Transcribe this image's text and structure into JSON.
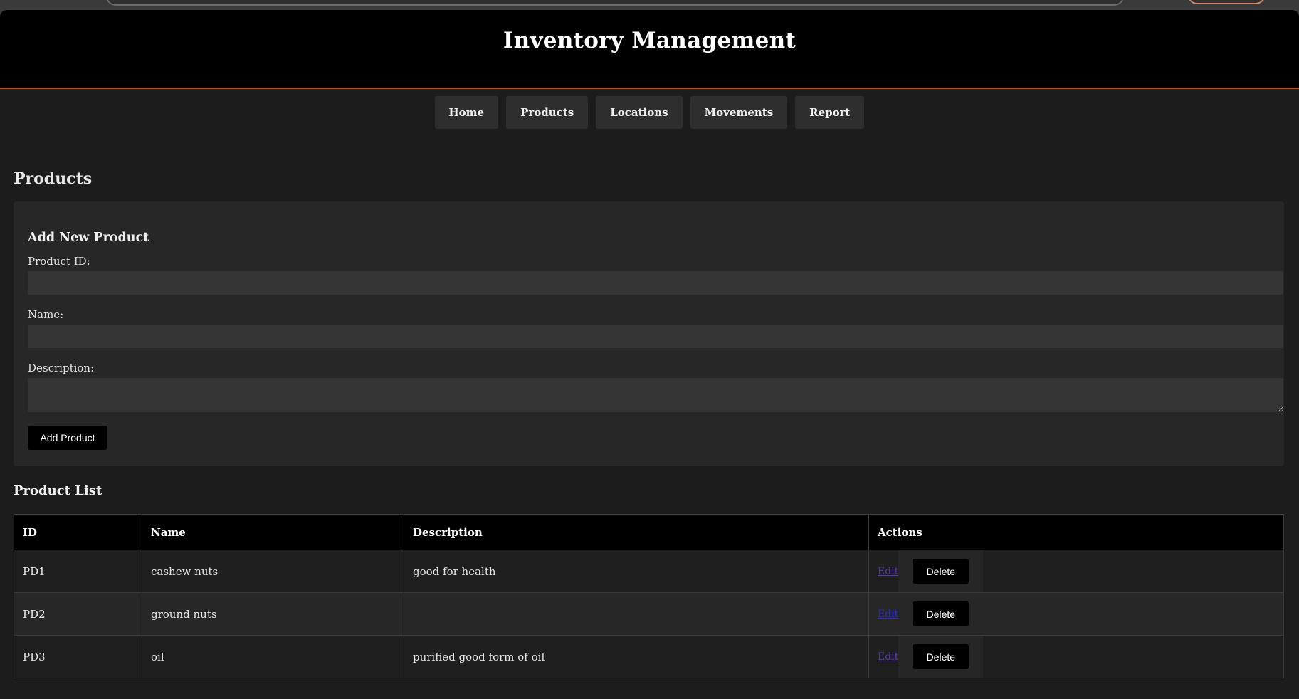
{
  "header": {
    "title": "Inventory Management"
  },
  "nav": {
    "items": [
      {
        "label": "Home"
      },
      {
        "label": "Products"
      },
      {
        "label": "Locations"
      },
      {
        "label": "Movements"
      },
      {
        "label": "Report"
      }
    ]
  },
  "page_title": "Products",
  "form": {
    "title": "Add New Product",
    "product_id_label": "Product ID:",
    "product_id_value": "",
    "name_label": "Name:",
    "name_value": "",
    "description_label": "Description:",
    "description_value": "",
    "submit_label": "Add Product"
  },
  "list": {
    "title": "Product List",
    "columns": [
      "ID",
      "Name",
      "Description",
      "Actions"
    ],
    "rows": [
      {
        "id": "PD1",
        "name": "cashew nuts",
        "description": "good for health",
        "edit_label": "Edit",
        "delete_label": "Delete"
      },
      {
        "id": "PD2",
        "name": "ground nuts",
        "description": "",
        "edit_label": "Edit",
        "delete_label": "Delete"
      },
      {
        "id": "PD3",
        "name": "oil",
        "description": "purified good form of oil",
        "edit_label": "Edit",
        "delete_label": "Delete"
      }
    ]
  },
  "colors": {
    "header_bg": "#000000",
    "accent_border": "#c8561e",
    "page_bg": "#1c1c1c",
    "card_bg": "#272727",
    "visited_link": "#5a3aa8",
    "link": "#2a2ad8"
  }
}
